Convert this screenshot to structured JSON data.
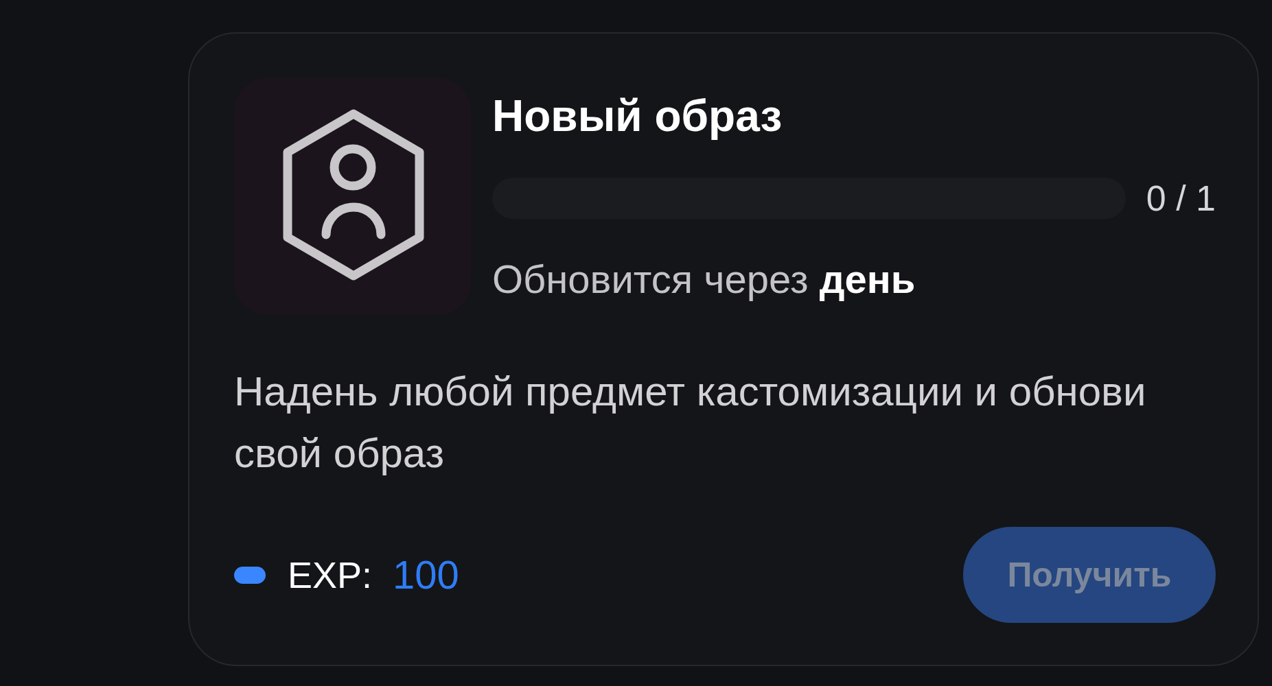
{
  "quest": {
    "title": "Новый образ",
    "progress": {
      "level": 0,
      "reading": "0 / 1"
    },
    "refresh_note": "Обновится через **день**",
    "description": "Надень любой предмет кастомизации и обнови свой образ",
    "reward": {
      "label": "EXP:",
      "value": "100"
    },
    "claim_button": {
      "label": "Получить",
      "disabled": true
    }
  }
}
